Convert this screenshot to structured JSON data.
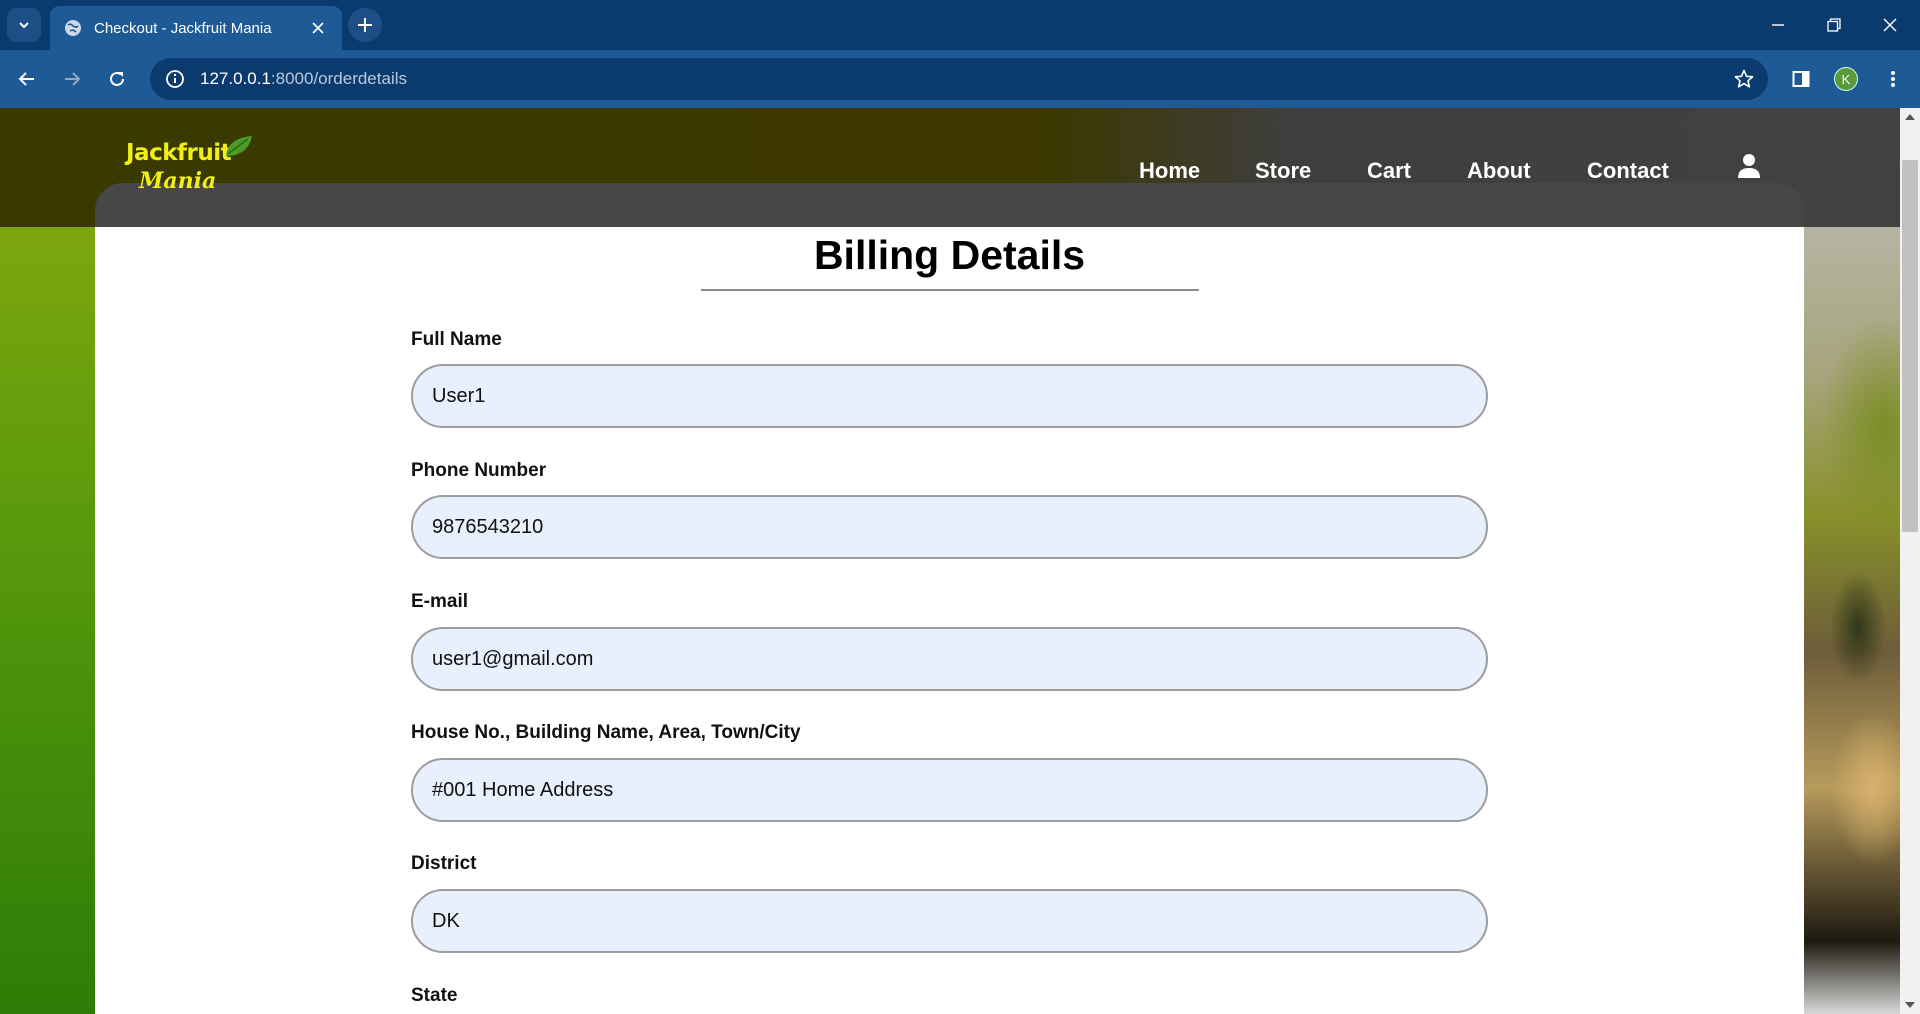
{
  "browser": {
    "tab_title": "Checkout - Jackfruit Mania",
    "url_host": "127.0.0.1",
    "url_path": ":8000/orderdetails",
    "profile_initial": "K"
  },
  "site": {
    "logo_line1": "Jackfruit",
    "logo_line2": "Mania",
    "nav": [
      "Home",
      "Store",
      "Cart",
      "About",
      "Contact"
    ]
  },
  "form": {
    "title": "Billing Details",
    "fields": [
      {
        "label": "Full Name",
        "value": "User1"
      },
      {
        "label": "Phone Number",
        "value": "9876543210"
      },
      {
        "label": "E-mail",
        "value": "user1@gmail.com"
      },
      {
        "label": "House No., Building Name, Area, Town/City",
        "value": "#001 Home Address"
      },
      {
        "label": "District",
        "value": "DK"
      },
      {
        "label": "State",
        "value": ""
      }
    ]
  },
  "colors": {
    "browser_frame": "#0b3a6e",
    "toolbar": "#1e5a96",
    "logo": "#f2ef16",
    "input_bg": "#e8f0fe"
  },
  "icons": [
    "tab-search-icon",
    "globe-icon",
    "close-icon",
    "plus-icon",
    "minimize-icon",
    "restore-icon",
    "back-icon",
    "forward-icon",
    "reload-icon",
    "info-icon",
    "star-icon",
    "sidebar-icon",
    "kebab-menu-icon",
    "user-icon",
    "leaf-icon"
  ]
}
